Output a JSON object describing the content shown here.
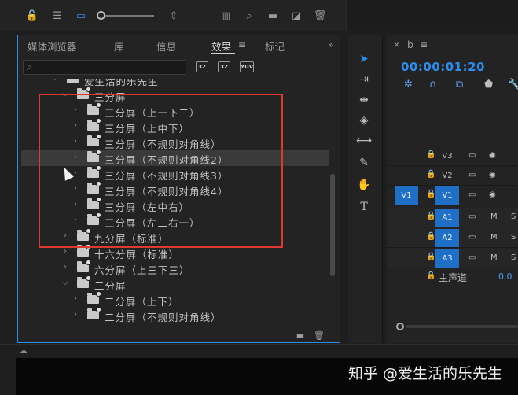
{
  "tabs": [
    {
      "label": "媒体浏览器"
    },
    {
      "label": "库"
    },
    {
      "label": "信息"
    },
    {
      "label": "效果",
      "active": true
    },
    {
      "label": "标记"
    }
  ],
  "tab_menu_icon": "≡",
  "overflow_icon": "»",
  "search": {
    "icon": "⌕",
    "value": ""
  },
  "filters": [
    {
      "label": "32",
      "icon": "accelerated-effects-icon"
    },
    {
      "label": "32",
      "icon": "32bit-color-icon"
    },
    {
      "label": "YUV",
      "icon": "yuv-effects-icon"
    }
  ],
  "tree": [
    {
      "label": "爱生活的乐先生",
      "depth": 0,
      "expanded": true
    },
    {
      "label": "三分屏",
      "depth": 1,
      "expanded": true
    },
    {
      "label": "三分屏（上一下二）",
      "depth": 2,
      "expanded": false
    },
    {
      "label": "三分屏（上中下）",
      "depth": 2,
      "expanded": false
    },
    {
      "label": "三分屏（不规则对角线）",
      "depth": 2,
      "expanded": false
    },
    {
      "label": "三分屏（不规则对角线2）",
      "depth": 2,
      "expanded": false,
      "hover": true
    },
    {
      "label": "三分屏（不规则对角线3）",
      "depth": 2,
      "expanded": false
    },
    {
      "label": "三分屏（不规则对角线4）",
      "depth": 2,
      "expanded": false
    },
    {
      "label": "三分屏（左中右）",
      "depth": 2,
      "expanded": false
    },
    {
      "label": "三分屏（左二右一）",
      "depth": 2,
      "expanded": false
    },
    {
      "label": "九分屏（标准）",
      "depth": 1,
      "expanded": false
    },
    {
      "label": "十六分屏（标准）",
      "depth": 1,
      "expanded": false
    },
    {
      "label": "六分屏（上三下三）",
      "depth": 1,
      "expanded": false
    },
    {
      "label": "二分屏",
      "depth": 1,
      "expanded": true
    },
    {
      "label": "二分屏（上下）",
      "depth": 2,
      "expanded": false
    },
    {
      "label": "二分屏（不规则对角线）",
      "depth": 2,
      "expanded": false
    }
  ],
  "timeline": {
    "tab_close": "×",
    "tab_name": "b",
    "tab_menu": "≡",
    "timecode": "00:00:01:20",
    "video_tracks": [
      {
        "name": "V3",
        "on": false,
        "source": ""
      },
      {
        "name": "V2",
        "on": false,
        "source": ""
      },
      {
        "name": "V1",
        "on": true,
        "source": "V1"
      }
    ],
    "audio_tracks": [
      {
        "name": "A1",
        "mute": "M",
        "solo": "S"
      },
      {
        "name": "A2",
        "mute": "M",
        "solo": "S"
      },
      {
        "name": "A3",
        "mute": "M",
        "solo": "S"
      }
    ],
    "master_label": "主声道",
    "master_value": "0.0"
  },
  "watermark": "知乎 @爱生活的乐先生",
  "colors": {
    "accent": "#2d8ceb",
    "highlight_box": "#e03a30"
  }
}
